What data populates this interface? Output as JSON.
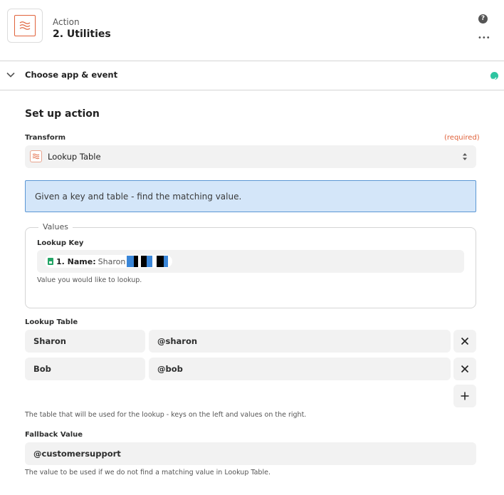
{
  "header": {
    "subtitle": "Action",
    "title": "2. Utilities",
    "app_icon": "utilities-waves-icon",
    "help_icon": "?",
    "more_icon": "•••"
  },
  "sections": {
    "choose_app": {
      "label": "Choose app & event",
      "status": "complete",
      "status_color": "#2dc5a1"
    }
  },
  "setup": {
    "title": "Set up action",
    "transform": {
      "label": "Transform",
      "required_label": "(required)",
      "value": "Lookup Table"
    },
    "info": "Given a key and table - find the matching value.",
    "values_group": {
      "legend": "Values",
      "lookup_key": {
        "label": "Lookup Key",
        "pill_key": "1. Name:",
        "pill_value": "Sharon",
        "hint": "Value you would like to lookup."
      }
    },
    "lookup_table": {
      "label": "Lookup Table",
      "rows": [
        {
          "key": "Sharon",
          "value": "@sharon"
        },
        {
          "key": "Bob",
          "value": "@bob"
        }
      ],
      "hint": "The table that will be used for the lookup - keys on the left and values on the right."
    },
    "fallback": {
      "label": "Fallback Value",
      "value": "@customersupport",
      "hint": "The value to be used if we do not find a matching value in Lookup Table."
    }
  },
  "colors": {
    "accent": "#e0623b",
    "info_bg": "#d4e6f9",
    "info_border": "#5b97d4",
    "success": "#2dc5a1",
    "field_bg": "#f2f2f2"
  }
}
